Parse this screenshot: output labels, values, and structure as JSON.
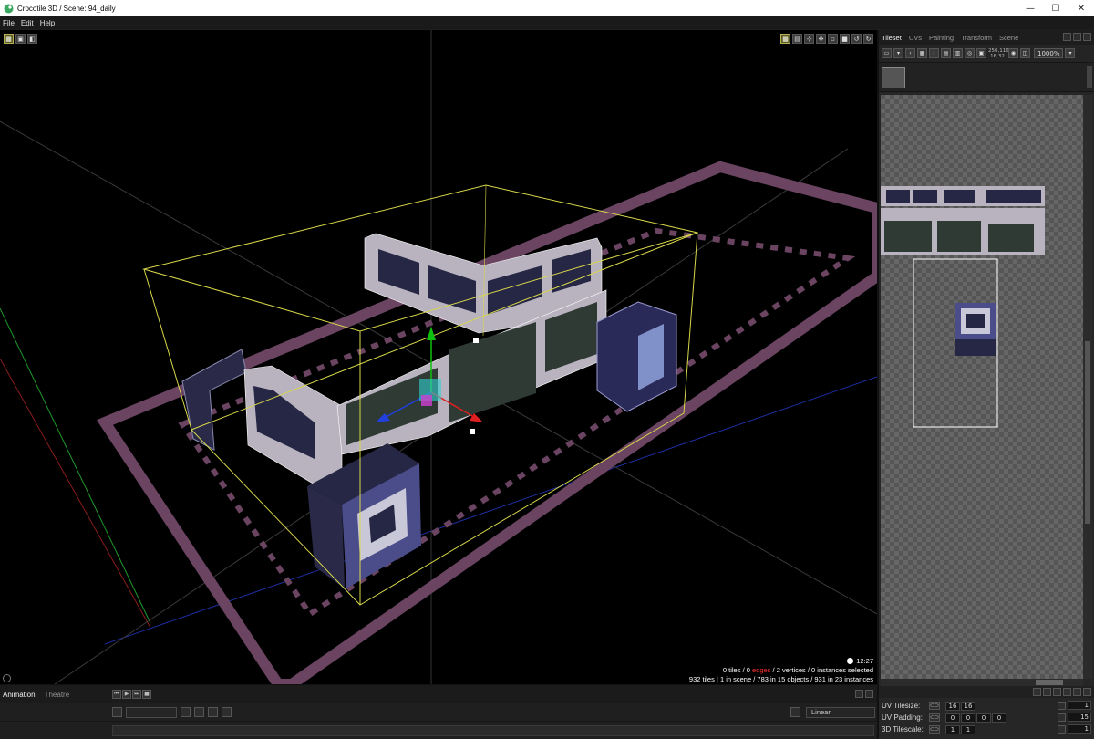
{
  "window": {
    "title": "Crocotile 3D / Scene: 94_daily",
    "minimize_glyph": "—",
    "maximize_glyph": "☐",
    "close_glyph": "✕"
  },
  "menu": [
    "File",
    "Edit",
    "Help"
  ],
  "viewport": {
    "clock": "12:27",
    "status_line1_prefix": "0 tiles / 0 ",
    "status_line1_red": "edges",
    "status_line1_suffix": " / 2 vertices / 0 instances selected",
    "status_line2": "932 tiles | 1 in scene / 783 in 15 objects / 931 in 23 instances"
  },
  "right_panel": {
    "tabs": [
      "Tileset",
      "UVs",
      "Painting",
      "Transform",
      "Scene"
    ],
    "active_tab": "Tileset",
    "readout_line1": "250,116",
    "readout_line2": "16,32",
    "zoom": "1000%",
    "uv_tilesize": {
      "label": "UV Tilesize:",
      "x": "16",
      "y": "16"
    },
    "uv_padding": {
      "label": "UV Padding:",
      "values": [
        "0",
        "0",
        "0",
        "0"
      ]
    },
    "tilescale": {
      "label": "3D Tilescale:",
      "x": "1",
      "y": "1"
    },
    "right_fields": [
      "1",
      "15",
      "1"
    ]
  },
  "bottom_panel": {
    "tabs": [
      "Animation",
      "Theatre"
    ],
    "active_tab": "Animation",
    "interpolation": "Linear"
  },
  "colors": {
    "floor": "#6a4461",
    "wall": "#b8b3bf",
    "window_dark": "#262645",
    "window_green": "#2f3a35",
    "selection": "#d8d84a"
  }
}
